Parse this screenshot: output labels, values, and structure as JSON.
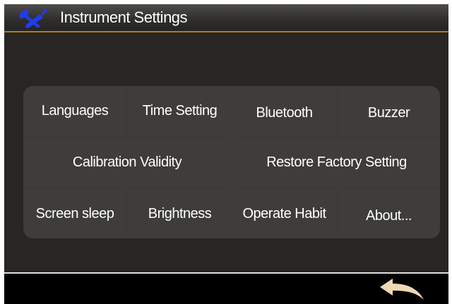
{
  "header": {
    "title": "Instrument Settings",
    "icon": "tools-icon",
    "icon_color": "#1f3cf0"
  },
  "menu": {
    "row1": [
      "Languages",
      "Time Setting",
      "Bluetooth",
      "Buzzer"
    ],
    "row2": [
      "Calibration Validity",
      "Restore Factory Setting"
    ],
    "row3": [
      "Screen sleep",
      "Brightness",
      "Operate Habit",
      "About..."
    ]
  },
  "footer": {
    "back_icon": "back-arrow-icon",
    "back_color": "#f0d8b4"
  },
  "colors": {
    "background": "#272624",
    "panel": "#3c3b39",
    "accent_line": "#b07a2e"
  }
}
